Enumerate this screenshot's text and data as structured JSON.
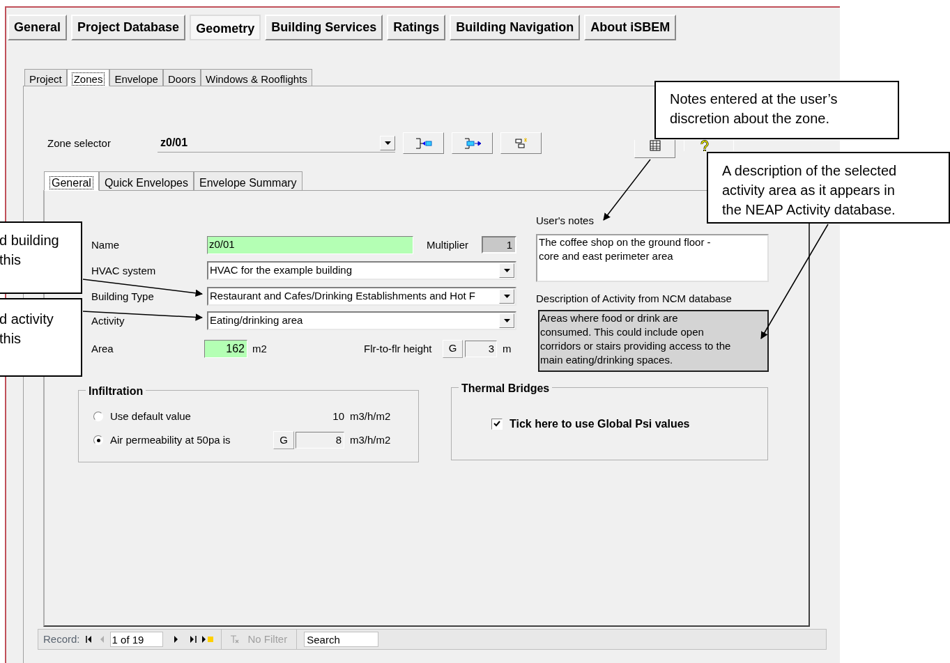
{
  "main_tabs": [
    {
      "label": "General",
      "selected": false
    },
    {
      "label": "Project Database",
      "selected": false
    },
    {
      "label": "Geometry",
      "selected": true
    },
    {
      "label": "Building Services",
      "selected": false
    },
    {
      "label": "Ratings",
      "selected": false
    },
    {
      "label": "Building Navigation",
      "selected": false
    },
    {
      "label": "About iSBEM",
      "selected": false
    }
  ],
  "sub_tabs": [
    {
      "label": "Project",
      "selected": false
    },
    {
      "label": "Zones",
      "selected": true
    },
    {
      "label": "Envelope",
      "selected": false
    },
    {
      "label": "Doors",
      "selected": false
    },
    {
      "label": "Windows & Rooflights",
      "selected": false
    }
  ],
  "zone_selector": {
    "label": "Zone selector",
    "value": "z0/01"
  },
  "zone_tabs": [
    {
      "label": "General",
      "selected": true
    },
    {
      "label": "Quick Envelopes",
      "selected": false
    },
    {
      "label": "Envelope Summary",
      "selected": false
    }
  ],
  "form": {
    "name": {
      "label": "Name",
      "value": "z0/01"
    },
    "multiplier": {
      "label": "Multiplier",
      "value": "1"
    },
    "hvac": {
      "label": "HVAC system",
      "value": "HVAC for the example building"
    },
    "building_type": {
      "label": "Building Type",
      "value": "Restaurant and Cafes/Drinking Establishments and Hot F"
    },
    "activity": {
      "label": "Activity",
      "value": "Eating/drinking area"
    },
    "area": {
      "label": "Area",
      "value": "162",
      "unit": "m2"
    },
    "floor_height": {
      "label": "Flr-to-flr height",
      "source": "G",
      "value": "3",
      "unit": "m"
    }
  },
  "users_notes": {
    "label": "User's notes",
    "lines": [
      "The coffee shop on the ground floor -",
      "core and east perimeter area"
    ]
  },
  "description": {
    "label": "Description of Activity from NCM database",
    "lines": [
      "Areas where food or drink are",
      "consumed. This could include open",
      "corridors or stairs providing access to the",
      "main eating/drinking spaces."
    ]
  },
  "infiltration": {
    "title": "Infiltration",
    "options": [
      {
        "label": "Use default value",
        "selected": false,
        "kind": "fixed",
        "value": "10",
        "unit": "m3/h/m2"
      },
      {
        "label": "Air permeability at 50pa is",
        "selected": true,
        "kind": "entry",
        "source": "G",
        "value": "8",
        "unit": "m3/h/m2"
      }
    ]
  },
  "thermal_bridges": {
    "title": "Thermal Bridges",
    "checkbox": {
      "label": "Tick here to use Global Psi values",
      "checked": true
    }
  },
  "record_nav": {
    "label": "Record:",
    "position": "1 of 19",
    "filter": "No Filter",
    "search": "Search"
  },
  "callouts": [
    {
      "lines": [
        "Notes entered at the user’s",
        "discretion about the zone."
      ]
    },
    {
      "lines": [
        "A description of the selected",
        "activity area as it appears in",
        "the NEAP Activity database."
      ]
    },
    {
      "lines": [
        "d building",
        "this"
      ]
    },
    {
      "lines": [
        "d activity",
        "this"
      ]
    }
  ]
}
